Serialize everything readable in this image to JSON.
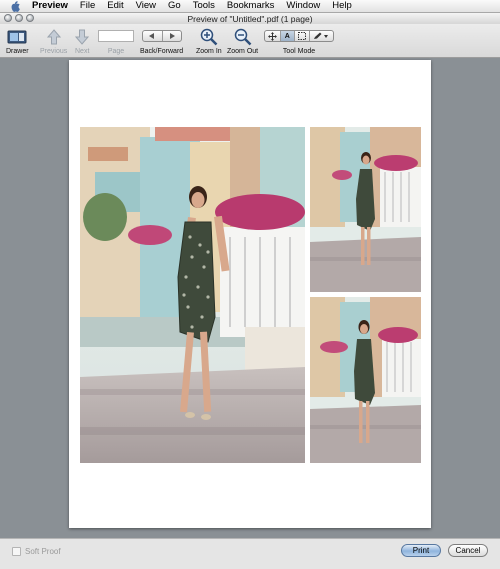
{
  "menubar": {
    "app_name": "Preview",
    "items": [
      "File",
      "Edit",
      "View",
      "Go",
      "Tools",
      "Bookmarks",
      "Window",
      "Help"
    ]
  },
  "window": {
    "title": "Preview of \"Untitled\".pdf (1 page)"
  },
  "toolbar": {
    "drawer_label": "Drawer",
    "previous_label": "Previous",
    "next_label": "Next",
    "page_label": "Page",
    "page_value": "",
    "back_forward_label": "Back/Forward",
    "zoom_in_label": "Zoom In",
    "zoom_out_label": "Zoom Out",
    "tool_mode_label": "Tool Mode",
    "tool_mode_selected": "text"
  },
  "bottom": {
    "soft_proof_label": "Soft Proof",
    "soft_proof_checked": false,
    "print_label": "Print",
    "cancel_label": "Cancel"
  },
  "colors": {
    "background": "#8a9095",
    "accent": "#8fb4dd"
  }
}
